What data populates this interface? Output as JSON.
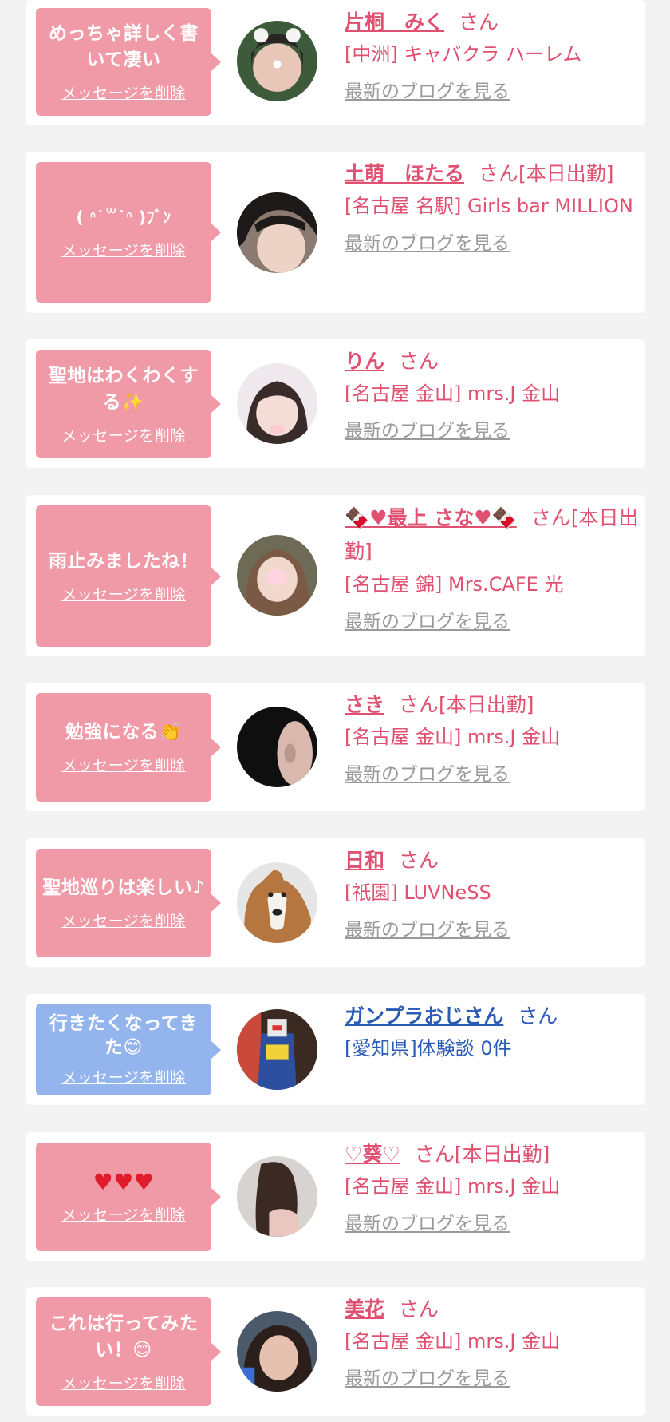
{
  "delete_label": "メッセージを削除",
  "blog_label": "最新のブログを見る",
  "items": [
    {
      "message": "めっちゃ詳しく書いて凄い",
      "name": "片桐　みく",
      "suffix": "さん",
      "shop": "[中洲] キャバクラ ハーレム",
      "theme": "pink"
    },
    {
      "message": "( ᐢ˙꒳˙ᐢ )ﾌﾞﾝ",
      "name": "土萌　ほたる",
      "suffix": "さん[本日出勤]",
      "shop": "[名古屋 名駅] Girls bar MILLION",
      "theme": "pink"
    },
    {
      "message": "聖地はわくわくする✨",
      "name": "りん",
      "suffix": "さん",
      "shop": "[名古屋 金山] mrs.J 金山",
      "theme": "pink"
    },
    {
      "message": "雨止みましたね！",
      "name": "🍫♥最上 さな♥🍫",
      "suffix": "さん[本日出勤]",
      "shop": "[名古屋 錦] Mrs.CAFE 光",
      "theme": "pink"
    },
    {
      "message": "勉強になる👏",
      "name": "さき",
      "suffix": "さん[本日出勤]",
      "shop": "[名古屋 金山] mrs.J 金山",
      "theme": "pink"
    },
    {
      "message": "聖地巡りは楽しい♪",
      "name": "日和",
      "suffix": "さん",
      "shop": "[祇園] LUVNeSS",
      "theme": "pink"
    },
    {
      "message": "行きたくなってきた😊",
      "name": "ガンプラおじさん",
      "suffix": "さん",
      "shop": "[愛知県]体験談 0件",
      "theme": "blue"
    },
    {
      "message": "♥♥♥",
      "name": "♡葵♡",
      "suffix": "さん[本日出勤]",
      "shop": "[名古屋 金山] mrs.J 金山",
      "theme": "pink"
    },
    {
      "message": "これは行ってみたい！😊",
      "name": "美花",
      "suffix": "さん",
      "shop": "[名古屋 金山] mrs.J 金山",
      "theme": "pink"
    }
  ]
}
